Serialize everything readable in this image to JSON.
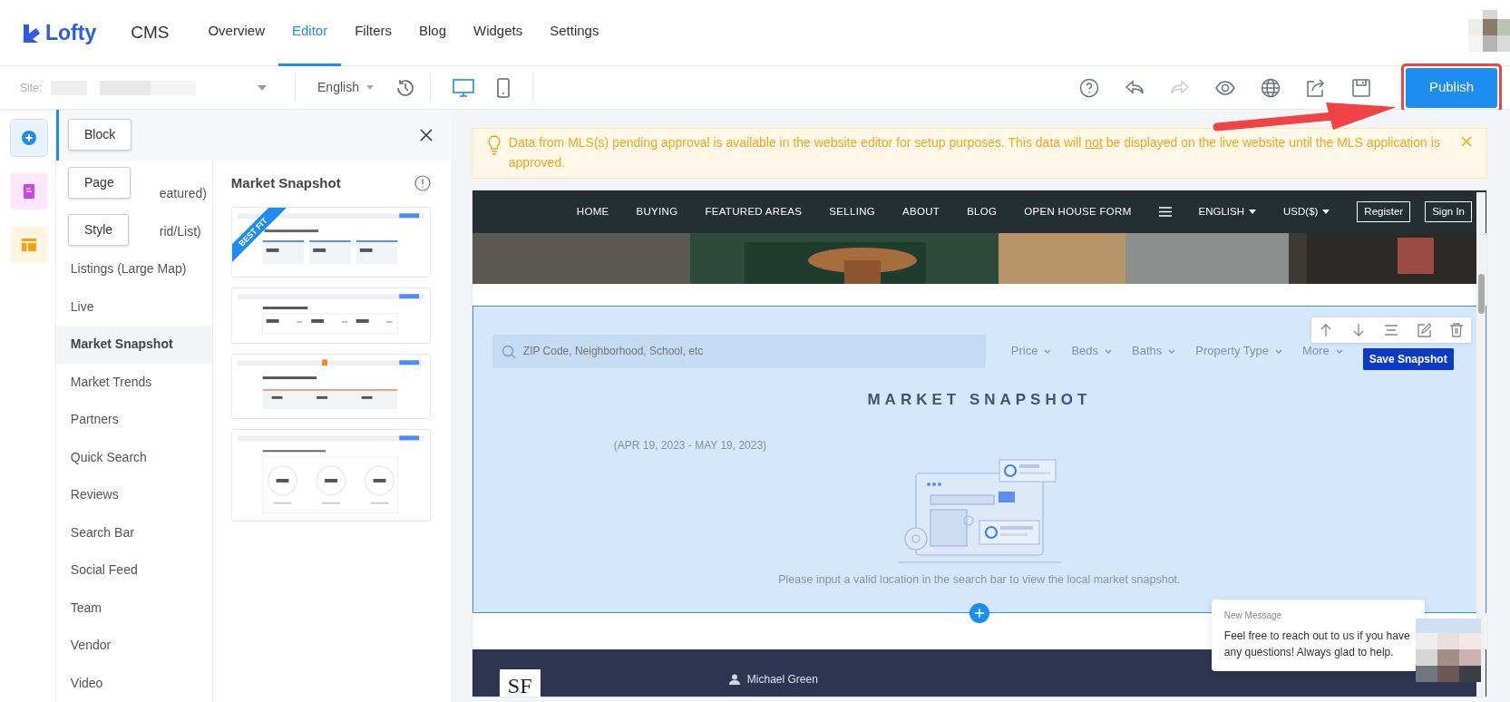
{
  "header": {
    "logo": "Lofty",
    "product": "CMS",
    "tabs": [
      {
        "label": "Overview",
        "selected": false
      },
      {
        "label": "Editor",
        "selected": true
      },
      {
        "label": "Filters",
        "selected": false
      },
      {
        "label": "Blog",
        "selected": false
      },
      {
        "label": "Widgets",
        "selected": false
      },
      {
        "label": "Settings",
        "selected": false
      }
    ]
  },
  "toolbar": {
    "site_label": "Site:",
    "language": "English",
    "devices": [
      {
        "kind": "desktop",
        "selected": true
      },
      {
        "kind": "mobile",
        "selected": false
      }
    ],
    "actions": [
      {
        "kind": "help",
        "disabled": false
      },
      {
        "kind": "undo",
        "disabled": false
      },
      {
        "kind": "redo",
        "disabled": true
      },
      {
        "kind": "preview",
        "disabled": false
      },
      {
        "kind": "globe",
        "disabled": false
      },
      {
        "kind": "share",
        "disabled": false
      },
      {
        "kind": "save",
        "disabled": false
      }
    ],
    "publish": "Publish"
  },
  "rail": [
    {
      "kind": "block",
      "label": "Block",
      "selected": true
    },
    {
      "kind": "page",
      "label": "Page",
      "selected": false
    },
    {
      "kind": "style",
      "label": "Style",
      "selected": false
    }
  ],
  "block_list": [
    {
      "label": "eatured)",
      "selected": false
    },
    {
      "label": "rid/List)",
      "selected": false
    },
    {
      "label": "Listings (Large Map)",
      "selected": false
    },
    {
      "label": "Live",
      "selected": false
    },
    {
      "label": "Market Snapshot",
      "selected": true
    },
    {
      "label": "Market Trends",
      "selected": false
    },
    {
      "label": "Partners",
      "selected": false
    },
    {
      "label": "Quick Search",
      "selected": false
    },
    {
      "label": "Reviews",
      "selected": false
    },
    {
      "label": "Search Bar",
      "selected": false
    },
    {
      "label": "Social Feed",
      "selected": false
    },
    {
      "label": "Team",
      "selected": false
    },
    {
      "label": "Vendor",
      "selected": false
    },
    {
      "label": "Video",
      "selected": false
    }
  ],
  "templates": {
    "title": "Market Snapshot",
    "items": [
      {
        "kind": "cards",
        "ribbon": "BEST FIT"
      },
      {
        "kind": "row"
      },
      {
        "kind": "orange"
      },
      {
        "kind": "circles"
      }
    ]
  },
  "alert": {
    "text_before": "Data from MLS(s) pending approval is available in the website editor for setup purposes. This data will",
    "underlined": "not",
    "text_after": "be displayed on the live website until the MLS application is approved."
  },
  "site": {
    "nav": [
      "HOME",
      "BUYING",
      "FEATURED AREAS",
      "SELLING",
      "ABOUT",
      "BLOG",
      "OPEN HOUSE FORM"
    ],
    "language": "ENGLISH",
    "currency": "USD($)",
    "register": "Register",
    "sign_in": "Sign In"
  },
  "snapshot": {
    "search_placeholder": "ZIP Code, Neighborhood, School, etc",
    "filters": [
      "Price",
      "Beds",
      "Baths",
      "Property Type",
      "More"
    ],
    "save": "Save Snapshot",
    "title": "MARKET SNAPSHOT",
    "date_range": "(APR 19, 2023 - MAY 19, 2023)",
    "message": "Please input a valid location in the search bar to view the local market snapshot."
  },
  "footer": {
    "logo": "SF",
    "agent": "Michael Green"
  },
  "chat": {
    "title": "New Message",
    "text": "Feel free to reach out to us if you have any questions! Always glad to help."
  }
}
